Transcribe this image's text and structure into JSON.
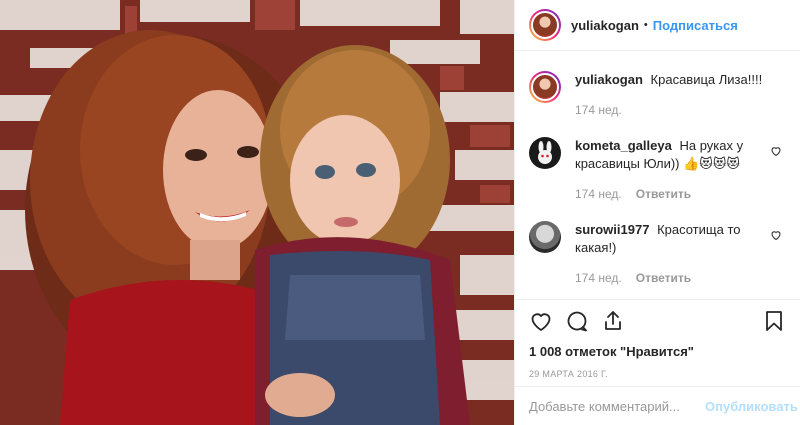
{
  "post": {
    "author": "yuliakogan",
    "header_separator": "•",
    "follow_label": "Подписаться",
    "photo_description_icon": "photo"
  },
  "comments": [
    {
      "user": "yuliakogan",
      "text": "Красавица Лиза!!!!",
      "time": "174 нед.",
      "reply": ""
    },
    {
      "user": "kometa_galleya",
      "text": "На руках у красавицы Юли)) 👍😻😻😻",
      "time": "174 нед.",
      "reply": "Ответить"
    },
    {
      "user": "surowii1977",
      "text": "Красотища то какая!)",
      "time": "174 нед.",
      "reply": "Ответить"
    }
  ],
  "actions": {
    "likes": "1 008 отметок \"Нравится\"",
    "date": "29 МАРТА 2016 Г."
  },
  "composer": {
    "placeholder": "Добавьте комментарий...",
    "publish_label": "Опубликовать"
  },
  "colors": {
    "link_blue": "#3897f0",
    "publish_disabled": "#b2dffc",
    "muted": "#999999",
    "text": "#262626"
  },
  "icons": [
    "heart-icon",
    "comment-icon",
    "share-icon",
    "bookmark-icon"
  ]
}
